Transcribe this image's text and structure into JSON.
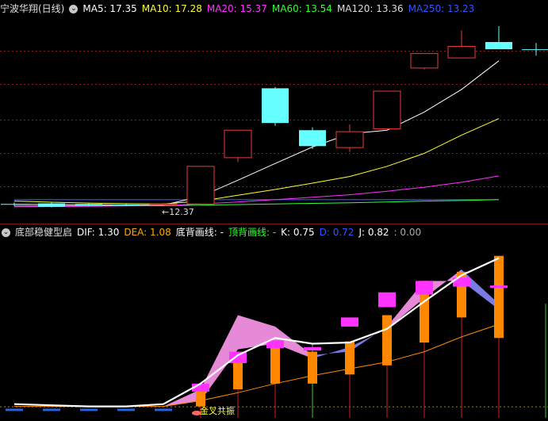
{
  "main_header": {
    "stock_label": "宁波华翔(日线)",
    "ma": [
      {
        "label": "MA5: 17.35",
        "color": "#ffffff"
      },
      {
        "label": "MA10: 17.28",
        "color": "#ffff33"
      },
      {
        "label": "MA20: 15.37",
        "color": "#ff33ff"
      },
      {
        "label": "MA60: 13.54",
        "color": "#33ff33"
      },
      {
        "label": "MA120: 13.36",
        "color": "#dddddd"
      },
      {
        "label": "MA250: 13.23",
        "color": "#3355ff"
      }
    ]
  },
  "main_annotation": "12.37",
  "indicator_header": {
    "name": "底部稳健型启",
    "items": [
      {
        "label": "DIF: 1.30",
        "color": "#ffffff"
      },
      {
        "label": "DEA: 1.08",
        "color": "#ffaa00"
      },
      {
        "label": "底背画线: -",
        "color": "#ffffff"
      },
      {
        "label": "顶背画线: -",
        "color": "#33ff33"
      },
      {
        "label": "K: 0.75",
        "color": "#ffffff"
      },
      {
        "label": "D: 0.72",
        "color": "#3355ff"
      },
      {
        "label": "J: 0.82",
        "color": "#ffffff"
      },
      {
        "label": ": 0.00",
        "color": "#aaaaaa"
      }
    ]
  },
  "indicator_annotation": "金叉共振",
  "colors": {
    "up": "#e83c3c",
    "down": "#66ffff",
    "grid": "#8b1a1a",
    "ma5": "#ffffff",
    "ma10": "#ffff33",
    "ma20": "#ff33ff",
    "ma60": "#33ff33",
    "ma250": "#3355ff",
    "bar_orange": "#ff8800",
    "bar_magenta": "#ff33ff",
    "band_pink": "#ff99ee",
    "band_blue": "#8888ff"
  },
  "chart_data": {
    "type": "candlestick",
    "candles": [
      {
        "o": 12.4,
        "c": 12.38,
        "h": 12.45,
        "l": 12.33
      },
      {
        "o": 12.42,
        "c": 12.3,
        "h": 12.46,
        "l": 12.28
      },
      {
        "o": 12.4,
        "c": 12.34,
        "h": 12.43,
        "l": 12.31
      },
      {
        "o": 12.38,
        "c": 12.36,
        "h": 12.41,
        "l": 12.33
      },
      {
        "o": 12.37,
        "c": 12.4,
        "h": 12.44,
        "l": 12.35
      },
      {
        "o": 12.4,
        "c": 13.7,
        "h": 13.7,
        "l": 12.37
      },
      {
        "o": 14.0,
        "c": 14.95,
        "h": 14.95,
        "l": 13.85
      },
      {
        "o": 16.4,
        "c": 15.2,
        "h": 16.45,
        "l": 15.1
      },
      {
        "o": 14.95,
        "c": 14.4,
        "h": 15.05,
        "l": 14.3
      },
      {
        "o": 14.35,
        "c": 14.9,
        "h": 15.15,
        "l": 14.2
      },
      {
        "o": 15.0,
        "c": 16.3,
        "h": 16.3,
        "l": 14.95
      },
      {
        "o": 17.1,
        "c": 17.6,
        "h": 17.6,
        "l": 17.05
      },
      {
        "o": 17.45,
        "c": 17.85,
        "h": 18.4,
        "l": 17.45
      },
      {
        "o": 18.0,
        "c": 17.75,
        "h": 18.55,
        "l": 17.75
      }
    ],
    "ma5": [
      12.39,
      12.38,
      12.37,
      12.36,
      12.36,
      12.66,
      13.22,
      13.8,
      14.37,
      14.83,
      14.95,
      15.58,
      16.36,
      17.35
    ],
    "ma10": [
      12.5,
      12.46,
      12.43,
      12.41,
      12.4,
      12.5,
      12.7,
      12.9,
      13.12,
      13.35,
      13.7,
      14.15,
      14.78,
      15.35
    ],
    "ma20": [
      12.3,
      12.31,
      12.32,
      12.33,
      12.34,
      12.4,
      12.47,
      12.55,
      12.63,
      12.72,
      12.84,
      12.98,
      13.15,
      13.37
    ],
    "ma60": [
      12.33,
      12.33,
      12.34,
      12.34,
      12.34,
      12.36,
      12.38,
      12.4,
      12.42,
      12.44,
      12.47,
      12.5,
      12.52,
      12.55
    ],
    "ma250": [
      12.55,
      12.55,
      12.55,
      12.55,
      12.55,
      12.55,
      12.55,
      12.55,
      12.55,
      12.55,
      12.55,
      12.55,
      12.55,
      12.55
    ],
    "price_range": [
      12.05,
      18.85
    ],
    "indicator": {
      "range": [
        -0.1,
        1.45
      ],
      "dif": [
        0.02,
        0.01,
        0.0,
        0.0,
        0.02,
        0.2,
        0.45,
        0.6,
        0.55,
        0.56,
        0.68,
        0.92,
        1.15,
        1.3
      ],
      "dea": [
        0.0,
        0.0,
        0.0,
        0.0,
        0.0,
        0.05,
        0.12,
        0.2,
        0.27,
        0.33,
        0.39,
        0.48,
        0.61,
        0.72
      ],
      "band_upper": [
        0.0,
        0.0,
        0.0,
        0.0,
        0.0,
        0.15,
        0.8,
        0.7,
        0.45,
        0.48,
        0.7,
        1.1,
        1.1,
        0.85
      ],
      "band_lower": [
        0.0,
        0.0,
        0.0,
        0.0,
        0.0,
        0.05,
        0.5,
        0.55,
        0.42,
        0.52,
        0.68,
        0.95,
        1.2,
        0.9
      ],
      "bars": [
        {
          "top": -0.02,
          "bottom": -0.04
        },
        {
          "top": -0.02,
          "bottom": -0.04
        },
        {
          "top": -0.02,
          "bottom": -0.04
        },
        {
          "top": -0.02,
          "bottom": -0.04
        },
        {
          "top": -0.02,
          "bottom": -0.04
        },
        {
          "top": 0.15,
          "bottom": 0.0
        },
        {
          "top": 0.45,
          "bottom": 0.15
        },
        {
          "top": 0.55,
          "bottom": 0.2
        },
        {
          "top": 0.48,
          "bottom": 0.2
        },
        {
          "top": 0.57,
          "bottom": 0.28
        },
        {
          "top": 0.8,
          "bottom": 0.36
        },
        {
          "top": 1.1,
          "bottom": 0.56
        },
        {
          "top": 1.18,
          "bottom": 0.78
        },
        {
          "top": 1.32,
          "bottom": 0.6
        }
      ],
      "boxes": [
        {
          "top": 0.2,
          "bottom": 0.13
        },
        {
          "top": 0.48,
          "bottom": 0.38
        },
        {
          "top": 0.58,
          "bottom": 0.51
        },
        {
          "top": 0.52,
          "bottom": 0.49
        },
        {
          "top": 0.78,
          "bottom": 0.7
        },
        {
          "top": 1.0,
          "bottom": 0.87
        },
        {
          "top": 1.1,
          "bottom": 0.98
        },
        {
          "top": 1.13,
          "bottom": 1.05
        },
        {
          "top": 1.06,
          "bottom": 1.04
        }
      ]
    }
  }
}
